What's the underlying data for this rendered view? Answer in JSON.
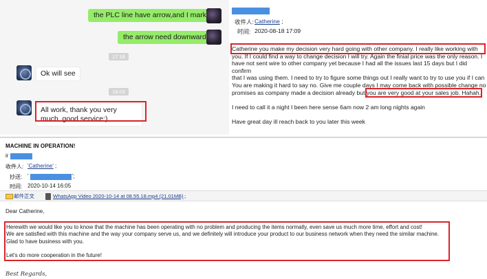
{
  "chat": {
    "messages": [
      {
        "from": "me",
        "text": "the PLC line have arrow,and I mark it"
      },
      {
        "from": "me",
        "text": "the arrow need downward"
      },
      {
        "from": "system",
        "text": "17:18"
      },
      {
        "from": "them",
        "text": "Ok will see"
      },
      {
        "from": "system",
        "text": "18:03"
      },
      {
        "from": "them",
        "text": "All work, thank you very much, good service:)"
      }
    ]
  },
  "email1": {
    "to_label": "收件人:",
    "to_value": "Catherine",
    "to_suffix": ";",
    "time_label": "时间:",
    "time_value": "2020-08-18 17:09",
    "body": {
      "p1_a": "Catherine you make my decision very hard going with other company. I really like working with",
      "p1_b": "you. If I could find a way to change decision I will try. Again the finial price was the only reason. I",
      "p1_c": "have not sent wire to other company yet because I had all the issues last 15 days but I did confirm",
      "p1_d": "that I was using them. I need to try to figure some things out I really want to try to use you if I can",
      "p1_e": "You are making it hard to say no.  Give me couple days I may come back with possible change no",
      "p1_f_pre": "promises as company made a decision already but ",
      "p1_f_hl": "you are very good at your sales job.  Hahah.",
      "p2": "I need to call it a night I been here sense 6am now 2 am  long nights again",
      "p3": "Have great day ill reach back to you later this week"
    }
  },
  "email2": {
    "subject": "MACHINE IN OPERATION!",
    "from_prefix": "ir",
    "to_label": "收件人:",
    "to_value": "'Catherine'",
    "to_suffix": ";",
    "cc_label": "抄送:",
    "cc_prefix": "'",
    "cc_suffix": "';",
    "time_label": "时间:",
    "time_value": "2020-10-14 16:05",
    "attachments": [
      {
        "icon": "envelope-icon",
        "label": "邮件正文"
      },
      {
        "icon": "video-file-icon",
        "label": "WhatsApp Video 2020-10-14 at 08.55.18.mp4 (21.01MB)",
        "suffix": ";"
      }
    ],
    "greeting": "Dear Catherine,",
    "body_lines": [
      "Herewith we would like you to know that the machine has been operating with no problem and producing the items normally, even save us much more time, effort and cost!",
      "We are satisfied with this machine and the way your company serve us, and we definitely will introduce your product to our business network when they need the similar machine.",
      "Glad to have business with you.",
      "",
      "Let's do more cooperation in the future!"
    ],
    "signature": "Best Regards,"
  },
  "colors": {
    "highlight_red": "#d8232a",
    "chat_green": "#95ec69",
    "redaction_blue": "#4a90e2",
    "link_blue": "#1a3e8c"
  }
}
